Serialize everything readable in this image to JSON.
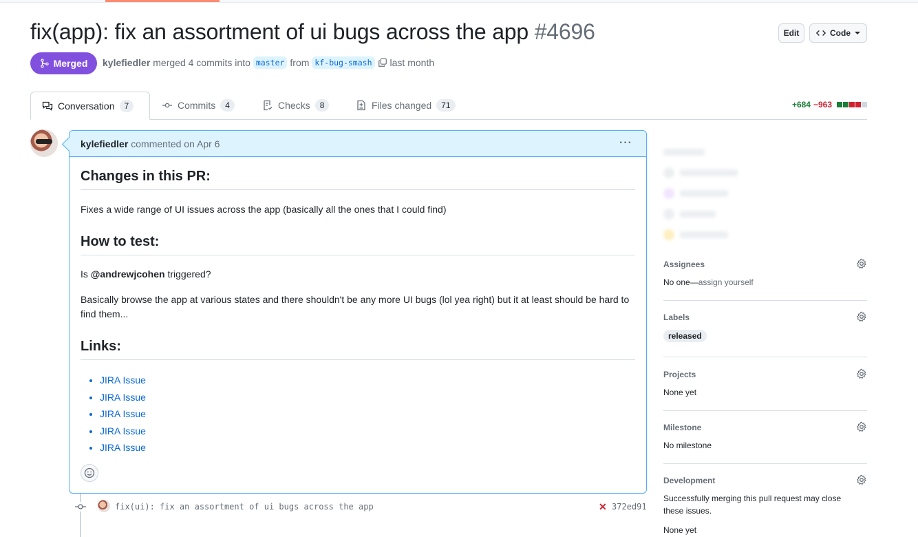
{
  "pr": {
    "title": "fix(app): fix an assortment of ui bugs across the app",
    "number": "#4696",
    "state": "Merged",
    "author": "kylefiedler",
    "merge_text": "merged 4 commits into",
    "base_branch": "master",
    "from_text": "from",
    "head_branch": "kf-bug-smash",
    "time": "last month"
  },
  "header_actions": {
    "edit_label": "Edit",
    "code_label": "Code"
  },
  "tabs": [
    {
      "label": "Conversation",
      "count": "7",
      "icon": "comment-discussion-icon"
    },
    {
      "label": "Commits",
      "count": "4",
      "icon": "git-commit-icon"
    },
    {
      "label": "Checks",
      "count": "8",
      "icon": "checklist-icon"
    },
    {
      "label": "Files changed",
      "count": "71",
      "icon": "file-diff-icon"
    }
  ],
  "diffstat": {
    "additions": "+684",
    "deletions": "−963",
    "colors": {
      "add": "#1a7f37",
      "del": "#cf222e",
      "neutral": "#d0d7de"
    }
  },
  "comment": {
    "author": "kylefiedler",
    "action": "commented on Apr 6",
    "h_changes": "Changes in this PR:",
    "p_changes": "Fixes a wide range of UI issues across the app (basically all the ones that I could find)",
    "h_test": "How to test:",
    "p_test_prefix": "Is",
    "p_test_mention": "@andrewjcohen",
    "p_test_suffix": "triggered?",
    "p_browse": "Basically browse the app at various states and there shouldn't be any more UI bugs (lol yea right) but it at least should be hard to find them...",
    "h_links": "Links:",
    "links": [
      "JIRA Issue",
      "JIRA Issue",
      "JIRA Issue",
      "JIRA Issue",
      "JIRA Issue"
    ]
  },
  "commit": {
    "message": "fix(ui): fix an assortment of ui bugs across the app",
    "status": "✕",
    "sha": "372ed91"
  },
  "sidebar": {
    "assignees": {
      "title": "Assignees",
      "prefix": "No one—",
      "link": "assign yourself"
    },
    "labels": {
      "title": "Labels",
      "items": [
        "released"
      ]
    },
    "projects": {
      "title": "Projects",
      "value": "None yet"
    },
    "milestone": {
      "title": "Milestone",
      "value": "No milestone"
    },
    "development": {
      "title": "Development",
      "value": "Successfully merging this pull request may close these issues.",
      "value2": "None yet"
    }
  }
}
